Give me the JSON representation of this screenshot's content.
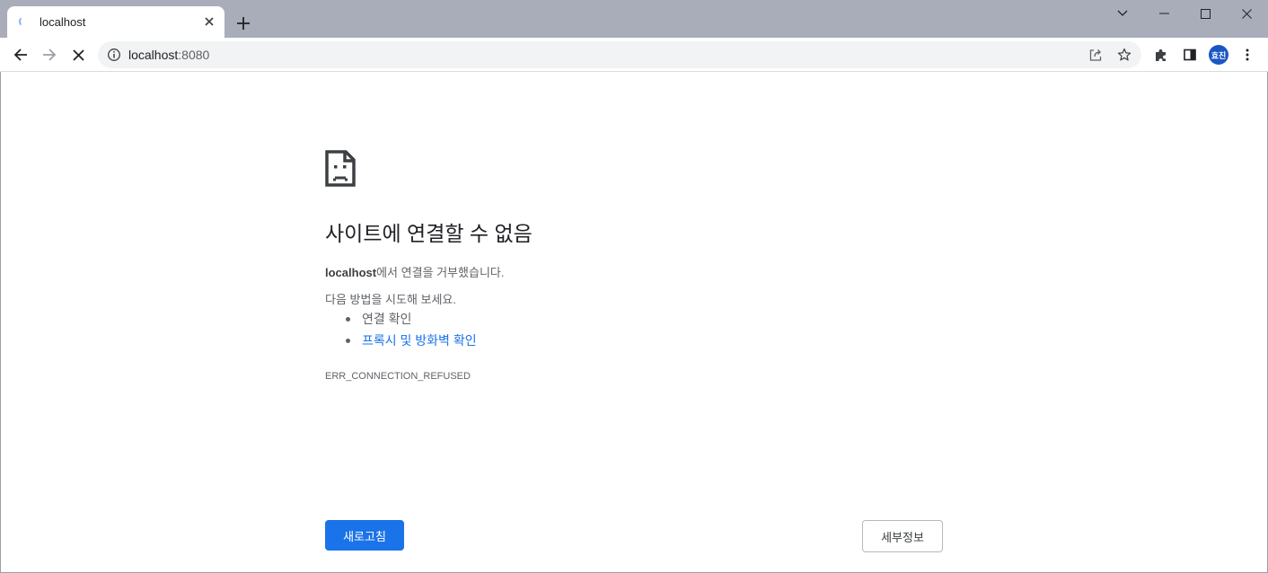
{
  "tab": {
    "title": "localhost",
    "spinner_icon": "loading-spinner-icon",
    "close_icon": "close-icon"
  },
  "tabstrip": {
    "new_tab_icon": "plus-icon",
    "tab_search_icon": "chevron-down-icon",
    "minimize_icon": "minimize-icon",
    "maximize_icon": "maximize-icon",
    "close_window_icon": "close-icon"
  },
  "toolbar": {
    "back_icon": "arrow-left-icon",
    "forward_icon": "arrow-right-icon",
    "stop_icon": "close-icon",
    "url_host": "localhost",
    "url_port": ":8080",
    "site_info_icon": "info-icon",
    "share_icon": "share-icon",
    "bookmark_icon": "star-icon",
    "extensions_icon": "puzzle-icon",
    "side_panel_icon": "side-panel-icon",
    "profile_initials": "효진",
    "menu_icon": "kebab-menu-icon"
  },
  "error": {
    "icon": "sad-page-icon",
    "heading": "사이트에 연결할 수 없음",
    "host": "localhost",
    "refused_text": "에서 연결을 거부했습니다.",
    "suggestions_title": "다음 방법을 시도해 보세요.",
    "suggestions": [
      {
        "label": "연결 확인"
      },
      {
        "label": "프록시 및 방화벽 확인"
      }
    ],
    "code": "ERR_CONNECTION_REFUSED",
    "reload_label": "새로고침",
    "details_label": "세부정보"
  },
  "colors": {
    "tabstrip_bg": "#a9adba",
    "accent": "#1a73e8",
    "avatar_bg": "#1a56c4",
    "muted_text": "#5f6368"
  }
}
